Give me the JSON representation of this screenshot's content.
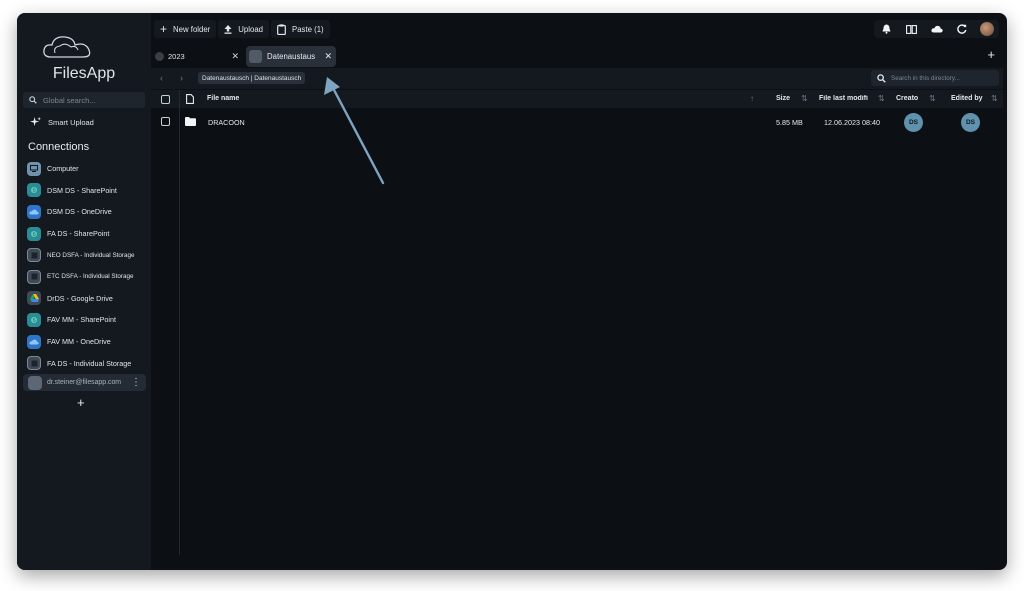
{
  "app": {
    "name": "FilesApp"
  },
  "sidebar": {
    "global_search_placeholder": "Global search...",
    "smart_upload_label": "Smart Upload",
    "connections_title": "Connections",
    "connections": [
      {
        "label": "Computer",
        "icon": "computer-icon",
        "color": "#6f93ad"
      },
      {
        "label": "DSM DS - SharePoint",
        "icon": "sharepoint-icon",
        "color": "#2a8d95"
      },
      {
        "label": "DSM DS - OneDrive",
        "icon": "onedrive-icon",
        "color": "#2f75c8"
      },
      {
        "label": "FA DS - SharePoint",
        "icon": "sharepoint-icon",
        "color": "#2a8d95"
      },
      {
        "label": "NEO DSFA - Individual Storage",
        "icon": "storage-icon",
        "color": "#3f4a58"
      },
      {
        "label": "ETC DSFA - Individual Storage",
        "icon": "storage-icon",
        "color": "#3f4a58"
      },
      {
        "label": "DrDS - Google Drive",
        "icon": "google-drive-icon",
        "color": "#3f4a58"
      },
      {
        "label": "FAV MM - SharePoint",
        "icon": "sharepoint-icon",
        "color": "#2a8d95"
      },
      {
        "label": "FAV MM - OneDrive",
        "icon": "onedrive-icon",
        "color": "#2f75c8"
      },
      {
        "label": "FA DS - Individual Storage",
        "icon": "storage-icon",
        "color": "#3f4a58"
      }
    ],
    "account_email": "dr.steiner@filesapp.com"
  },
  "toolbar": {
    "new_folder_label": "New folder",
    "upload_label": "Upload",
    "paste_label": "Paste (1)"
  },
  "tabs": [
    {
      "label": "2023"
    },
    {
      "label": "Datenaustausch"
    }
  ],
  "pathbar": {
    "breadcrumb": "Datenaustausch | Datenaustausch",
    "search_placeholder": "Search in this directory..."
  },
  "table": {
    "columns": {
      "name": "File name",
      "size": "Size",
      "modified": "File last modifi",
      "created": "Creato",
      "edited": "Edited by"
    },
    "rows": [
      {
        "name": "DRACOON",
        "size": "5.85 MB",
        "modified": "12.06.2023 08:40",
        "created_by": "DS",
        "edited_by": "DS"
      }
    ]
  },
  "colors": {
    "accent": "#5f92ad",
    "background": "#0c0f14",
    "panel": "#141920",
    "annotation_arrow": "#7ea4c2"
  }
}
